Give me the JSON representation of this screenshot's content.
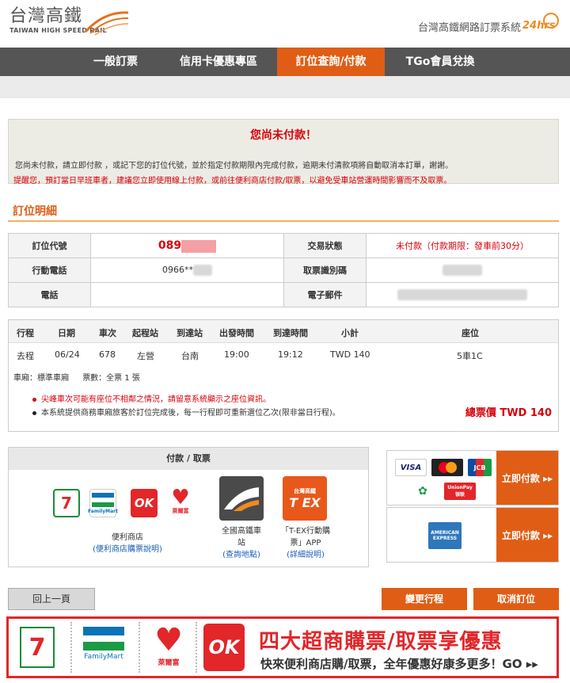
{
  "header": {
    "logo_cn": "台灣高鐵",
    "logo_en": "TAIWAN HIGH SPEED RAIL",
    "system_title": "台灣高鐵網路訂票系統",
    "badge": "24hrs"
  },
  "nav": {
    "items": [
      "一般訂票",
      "信用卡優惠專區",
      "訂位查詢/付款",
      "TGo會員兌換"
    ]
  },
  "alert": {
    "title": "您尚未付款！",
    "line1": "您尚未付款，請立即付款 ，或記下您的訂位代號，並於指定付款期限內完成付款，逾期未付清款項將自動取消本訂單，謝謝。",
    "line2": "提醒您，預訂當日早班車者，建議您立即使用線上付款，或前往便利商店付款/取票，以避免受車站營運時間影響而不及取票。"
  },
  "booking": {
    "section_title": "訂位明細",
    "code_label": "訂位代號",
    "code_value": "089",
    "status_label": "交易狀態",
    "status_value": "未付款（付款期限：發車前30分）",
    "mobile_label": "行動電話",
    "mobile_value": "0966**",
    "ticket_id_label": "取票識別碼",
    "phone_label": "電話",
    "email_label": "電子郵件"
  },
  "trip": {
    "headers": [
      "行程",
      "日期",
      "車次",
      "起程站",
      "到達站",
      "出發時間",
      "到達時間",
      "小計",
      "座位"
    ],
    "row": [
      "去程",
      "06/24",
      "678",
      "左營",
      "台南",
      "19:00",
      "19:12",
      "TWD 140",
      "5車1C"
    ],
    "car_type": "車廂：標準車廂",
    "ticket_count": "票數：全票 1 張",
    "note1": "尖峰車次可能有座位不相鄰之情況，請留意系統顯示之座位資訊。",
    "note2": "本系統提供商務車廂旅客於訂位完成後，每一行程即可重新選位乙次(限非當日行程)。",
    "total": "總票價 TWD 140"
  },
  "payment": {
    "title": "付款 / 取票",
    "store_caption": "便利商店",
    "store_link": "(便利商店購票說明)",
    "station_caption_1": "全國高鐵車",
    "station_caption_2": "站",
    "station_link": "(查詢地點)",
    "tex_caption_1": "「T-EX行動購",
    "tex_caption_2": "票」APP",
    "tex_link": "(詳細說明)",
    "logo_711": "7-ELEVEN",
    "logo_fm": "FamilyMart",
    "logo_ok": "OK",
    "logo_hilife": "Hi-Life",
    "logo_hilife_cn": "萊爾富",
    "logo_tex_top": "台灣高鐵",
    "logo_tex": "T EX",
    "pay_now_1": "立即付款 ▸▸",
    "pay_now_2": "立即付款 ▸▸",
    "card_visa": "VISA",
    "card_jcb": "JCB",
    "card_unionpay": "UnionPay",
    "card_unionpay_cn": "银联",
    "card_amex_1": "AMERICAN",
    "card_amex_2": "EXPRESS"
  },
  "buttons": {
    "back": "回上一頁",
    "change": "變更行程",
    "cancel": "取消訂位"
  },
  "banner": {
    "title": "四大超商購票/取票享優惠",
    "subtitle": "快來便利商店購/取票，全年優惠好康多更多！GO ▸▸",
    "fm_label": "FamilyMart",
    "hilife_cn": "萊爾富",
    "ok_label": "OK",
    "eleven_label": "7-ELEVEN"
  },
  "colors": {
    "brand_orange": "#e05d15",
    "alert_red": "#d8000a",
    "nav_gray": "#555555"
  }
}
